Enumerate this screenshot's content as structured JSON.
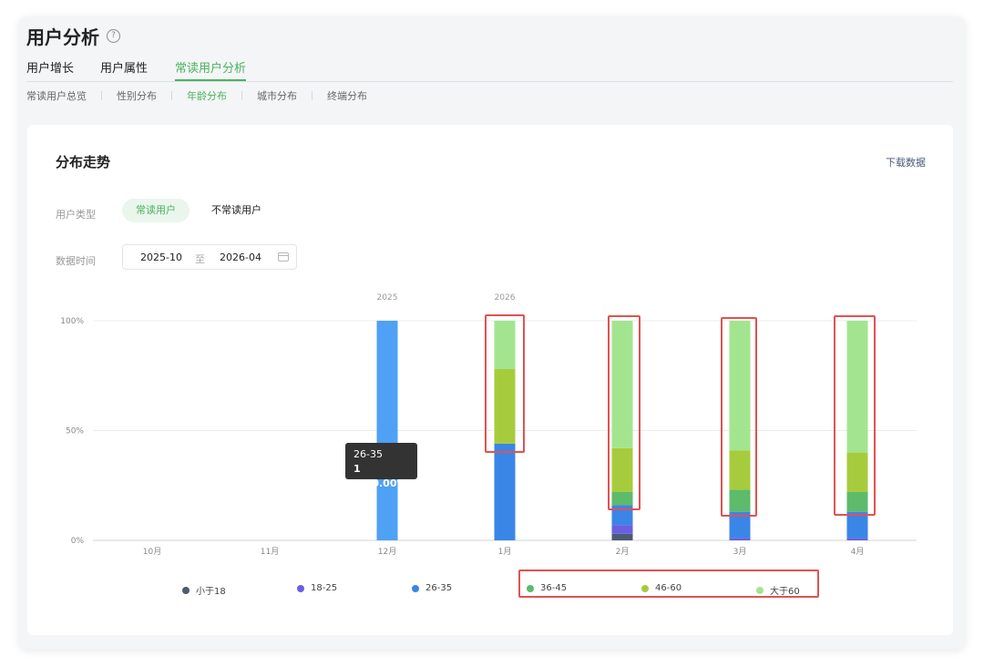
{
  "header": {
    "title": "用户分析",
    "help_icon": "question-circle-icon"
  },
  "tabs": [
    {
      "label": "用户增长",
      "active": false
    },
    {
      "label": "用户属性",
      "active": false
    },
    {
      "label": "常读用户分析",
      "active": true
    }
  ],
  "subtabs": [
    {
      "label": "常读用户总览",
      "active": false
    },
    {
      "label": "性别分布",
      "active": false
    },
    {
      "label": "年龄分布",
      "active": true
    },
    {
      "label": "城市分布",
      "active": false
    },
    {
      "label": "终端分布",
      "active": false
    }
  ],
  "card": {
    "title": "分布走势",
    "download_label": "下载数据",
    "user_type_label": "用户类型",
    "user_type_options": [
      {
        "label": "常读用户",
        "selected": true
      },
      {
        "label": "不常读用户",
        "selected": false
      }
    ],
    "date_label": "数据时间",
    "date_start": "2025-10",
    "date_sep": "至",
    "date_end": "2026-04",
    "calendar_icon": "calendar-icon"
  },
  "colors": {
    "accent": "#4bb25c",
    "highlight_box": "#e15252",
    "grid": "#e9ecef"
  },
  "chart_data": {
    "type": "bar",
    "stacked": true,
    "categories": [
      "10月",
      "11月",
      "12月",
      "1月",
      "2月",
      "3月",
      "4月"
    ],
    "year_labels": [
      {
        "text": "2025",
        "at": "12月"
      },
      {
        "text": "2026",
        "at": "1月"
      }
    ],
    "y_ticks": [
      "0%",
      "50%",
      "100%"
    ],
    "ylim": [
      0,
      100
    ],
    "grid": true,
    "legend_position": "bottom",
    "series": [
      {
        "name": "小于18",
        "color": "#4d5a73",
        "values": [
          0,
          0,
          0,
          0,
          3,
          0,
          0
        ]
      },
      {
        "name": "18-25",
        "color": "#6a5fe0",
        "values": [
          0,
          0,
          0,
          0,
          4,
          1,
          1
        ]
      },
      {
        "name": "26-35",
        "color": "#3a86e6",
        "values": [
          0,
          0,
          100,
          44,
          9,
          12,
          12
        ]
      },
      {
        "name": "36-45",
        "color": "#5dbb6b",
        "values": [
          0,
          0,
          0,
          0,
          6,
          10,
          9
        ]
      },
      {
        "name": "46-60",
        "color": "#a6cc3d",
        "values": [
          0,
          0,
          0,
          34,
          20,
          18,
          18
        ]
      },
      {
        "name": "大于60",
        "color": "#a3e58f",
        "values": [
          0,
          0,
          0,
          22,
          58,
          59,
          60
        ]
      }
    ],
    "tooltip": {
      "category": "12月",
      "label": "26-35",
      "value_text": "1 (100.00%)"
    }
  }
}
